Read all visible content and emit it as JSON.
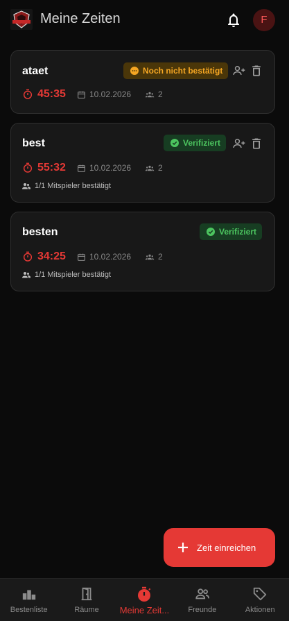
{
  "header": {
    "title": "Meine Zeiten",
    "avatar_initial": "F"
  },
  "entries": [
    {
      "name": "ataet",
      "status": "Noch nicht bestätigt",
      "time": "45:35",
      "date": "10.02.2026",
      "players": "2",
      "confirmations": ""
    },
    {
      "name": "best",
      "status": "Verifiziert",
      "time": "55:32",
      "date": "10.02.2026",
      "players": "2",
      "confirmations": "1/1 Mitspieler bestätigt"
    },
    {
      "name": "besten",
      "status": "Verifiziert",
      "time": "34:25",
      "date": "10.02.2026",
      "players": "2",
      "confirmations": "1/1 Mitspieler bestätigt"
    }
  ],
  "fab": {
    "label": "Zeit einreichen"
  },
  "nav": [
    {
      "label": "Bestenliste",
      "icon": "leaderboard-icon"
    },
    {
      "label": "Räume",
      "icon": "door-icon"
    },
    {
      "label": "Meine Zeit...",
      "icon": "timer-icon",
      "active": true
    },
    {
      "label": "Freunde",
      "icon": "friends-icon"
    },
    {
      "label": "Aktionen",
      "icon": "tag-icon"
    }
  ],
  "colors": {
    "accent": "#e53935",
    "pending": "#f5a623",
    "verified": "#4cc45f",
    "background": "#0b0b0b"
  }
}
